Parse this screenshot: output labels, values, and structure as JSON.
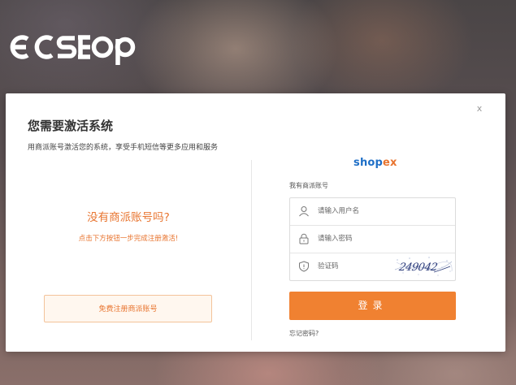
{
  "brand": {
    "logo_text": "ecstop",
    "accent_color": "#f08131",
    "link_color": "#e8742f"
  },
  "modal": {
    "close_label": "x",
    "title": "您需要激活系统",
    "subtitle": "用商派账号激活您的系统，享受手机短信等更多应用和服务"
  },
  "left": {
    "no_account_title": "没有商派账号吗?",
    "no_account_hint": "点击下方按钮一步完成注册激活!",
    "register_label": "免费注册商派账号"
  },
  "right": {
    "shopex_logo": {
      "part1": "shop",
      "part2": "ex"
    },
    "have_account_label": "我有商派账号",
    "username": {
      "placeholder": "请输入用户名",
      "value": ""
    },
    "password": {
      "placeholder": "请输入密码",
      "value": ""
    },
    "captcha": {
      "placeholder": "验证码",
      "value": "",
      "image_text": "249042"
    },
    "login_label": "登录",
    "forgot_label": "忘记密码?"
  },
  "icons": {
    "username": "user-icon",
    "password": "lock-icon",
    "captcha": "shield-icon"
  }
}
